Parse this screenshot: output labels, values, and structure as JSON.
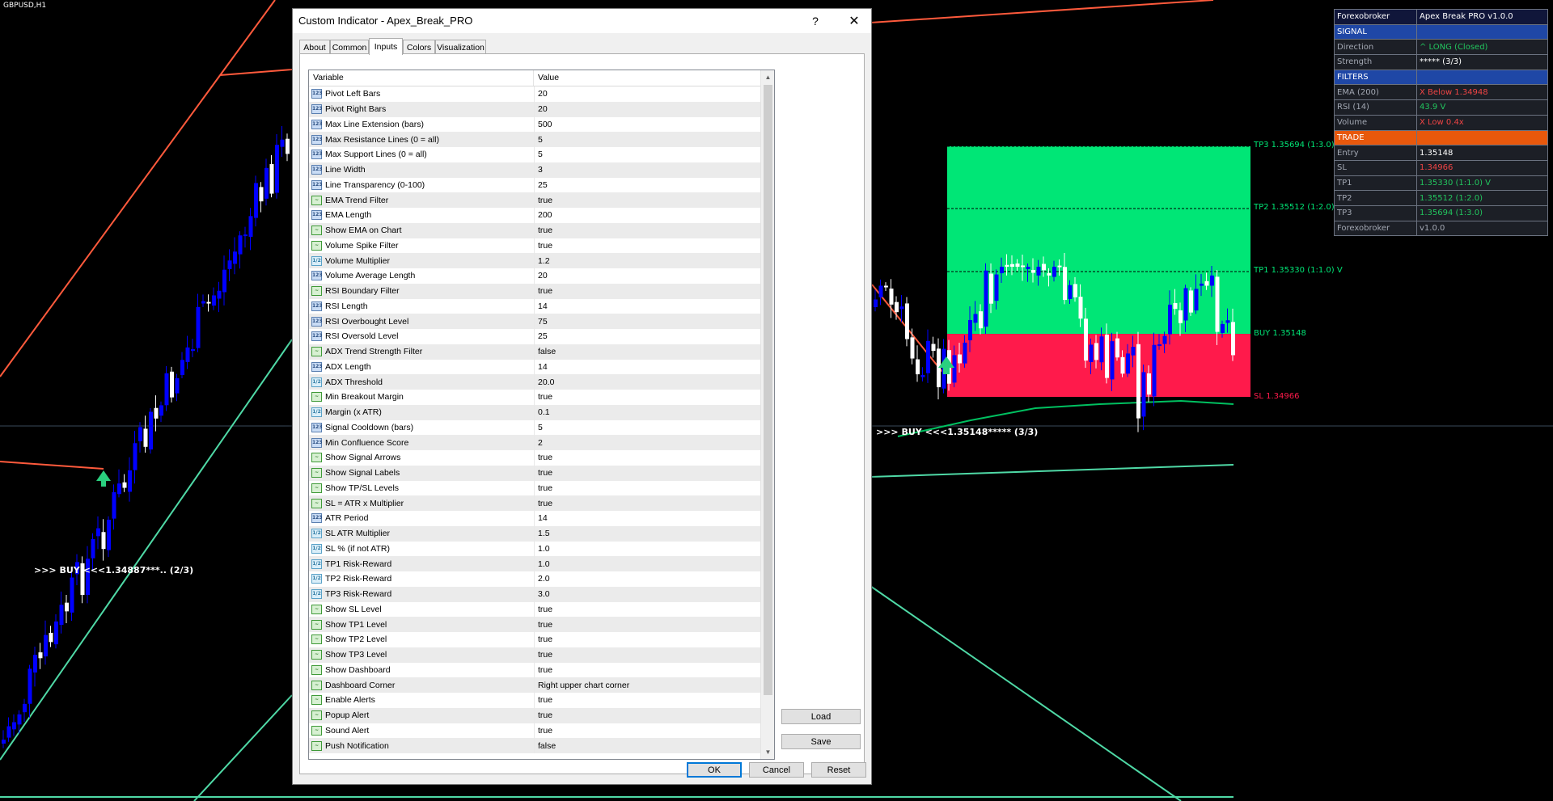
{
  "chart": {
    "symbol": "GBPUSD,H1",
    "buy_labels": [
      ">>> BUY <<<1.34887***.. (2/3)",
      ">>> BUY <<<1.35148***** (3/3)"
    ],
    "levels": {
      "tp3": "TP3 1.35694 (1:3.0)",
      "tp2": "TP2 1.35512 (1:2.0)",
      "tp1": "TP1 1.35330 (1:1.0) V",
      "buy": "BUY 1.35148",
      "sl": "SL 1.34966"
    },
    "colors": {
      "bull": "#0000ff",
      "bear": "#ffffff",
      "resistance": "#ff5a3c",
      "support": "#4fd9a6",
      "tp_zone": "#00e676",
      "sl_zone": "#ff1a4b",
      "arrow": "#2ad07f",
      "ema": "#00c060"
    }
  },
  "dashboard": {
    "rows": [
      {
        "type": "head",
        "k": "Forexobroker",
        "v": "Apex Break PRO v1.0.0"
      },
      {
        "type": "section",
        "k": "SIGNAL",
        "v": ""
      },
      {
        "type": "item",
        "k": "Direction",
        "v": "^ LONG (Closed)",
        "tone": "green"
      },
      {
        "type": "item",
        "k": "Strength",
        "v": "***** (3/3)",
        "tone": "white"
      },
      {
        "type": "section",
        "k": "FILTERS",
        "v": ""
      },
      {
        "type": "item",
        "k": "EMA (200)",
        "v": "X Below 1.34948",
        "tone": "red"
      },
      {
        "type": "item",
        "k": "RSI (14)",
        "v": "43.9 V",
        "tone": "green"
      },
      {
        "type": "item",
        "k": "Volume",
        "v": "X Low 0.4x",
        "tone": "red"
      },
      {
        "type": "trade",
        "k": "TRADE",
        "v": ""
      },
      {
        "type": "item",
        "k": "Entry",
        "v": "1.35148",
        "tone": "white"
      },
      {
        "type": "item",
        "k": "SL",
        "v": "1.34966",
        "tone": "red"
      },
      {
        "type": "item",
        "k": "TP1",
        "v": "1.35330 (1:1.0) V",
        "tone": "green"
      },
      {
        "type": "item",
        "k": "TP2",
        "v": "1.35512 (1:2.0)",
        "tone": "green"
      },
      {
        "type": "item",
        "k": "TP3",
        "v": "1.35694 (1:3.0)",
        "tone": "green"
      },
      {
        "type": "item",
        "k": "Forexobroker",
        "v": "v1.0.0",
        "tone": "grey"
      }
    ]
  },
  "dialog": {
    "title": "Custom Indicator - Apex_Break_PRO",
    "help": "?",
    "close": "✕",
    "tabs": [
      "About",
      "Common",
      "Inputs",
      "Colors",
      "Visualization"
    ],
    "active_tab": "Inputs",
    "columns": {
      "variable": "Variable",
      "value": "Value"
    },
    "params": [
      {
        "name": "Pivot Left Bars",
        "value": "20",
        "type": "int"
      },
      {
        "name": "Pivot Right Bars",
        "value": "20",
        "type": "int"
      },
      {
        "name": "Max Line Extension (bars)",
        "value": "500",
        "type": "int"
      },
      {
        "name": "Max Resistance Lines (0 = all)",
        "value": "5",
        "type": "int"
      },
      {
        "name": "Max Support Lines (0 = all)",
        "value": "5",
        "type": "int"
      },
      {
        "name": "Line Width",
        "value": "3",
        "type": "int"
      },
      {
        "name": "Line Transparency (0-100)",
        "value": "25",
        "type": "int"
      },
      {
        "name": "EMA Trend Filter",
        "value": "true",
        "type": "bool"
      },
      {
        "name": "EMA Length",
        "value": "200",
        "type": "int"
      },
      {
        "name": "Show EMA on Chart",
        "value": "true",
        "type": "bool"
      },
      {
        "name": "Volume Spike Filter",
        "value": "true",
        "type": "bool"
      },
      {
        "name": "Volume Multiplier",
        "value": "1.2",
        "type": "double"
      },
      {
        "name": "Volume Average Length",
        "value": "20",
        "type": "int"
      },
      {
        "name": "RSI Boundary Filter",
        "value": "true",
        "type": "bool"
      },
      {
        "name": "RSI Length",
        "value": "14",
        "type": "int"
      },
      {
        "name": "RSI Overbought Level",
        "value": "75",
        "type": "int"
      },
      {
        "name": "RSI Oversold Level",
        "value": "25",
        "type": "int"
      },
      {
        "name": "ADX Trend Strength Filter",
        "value": "false",
        "type": "bool"
      },
      {
        "name": "ADX Length",
        "value": "14",
        "type": "int"
      },
      {
        "name": "ADX Threshold",
        "value": "20.0",
        "type": "double"
      },
      {
        "name": "Min Breakout Margin",
        "value": "true",
        "type": "bool"
      },
      {
        "name": "Margin (x ATR)",
        "value": "0.1",
        "type": "double"
      },
      {
        "name": "Signal Cooldown (bars)",
        "value": "5",
        "type": "int"
      },
      {
        "name": "Min Confluence Score",
        "value": "2",
        "type": "int"
      },
      {
        "name": "Show Signal Arrows",
        "value": "true",
        "type": "bool"
      },
      {
        "name": "Show Signal Labels",
        "value": "true",
        "type": "bool"
      },
      {
        "name": "Show TP/SL Levels",
        "value": "true",
        "type": "bool"
      },
      {
        "name": "SL = ATR x Multiplier",
        "value": "true",
        "type": "bool"
      },
      {
        "name": "ATR Period",
        "value": "14",
        "type": "int"
      },
      {
        "name": "SL ATR Multiplier",
        "value": "1.5",
        "type": "double"
      },
      {
        "name": "SL % (if not ATR)",
        "value": "1.0",
        "type": "double"
      },
      {
        "name": "TP1 Risk-Reward",
        "value": "1.0",
        "type": "double"
      },
      {
        "name": "TP2 Risk-Reward",
        "value": "2.0",
        "type": "double"
      },
      {
        "name": "TP3 Risk-Reward",
        "value": "3.0",
        "type": "double"
      },
      {
        "name": "Show SL Level",
        "value": "true",
        "type": "bool"
      },
      {
        "name": "Show TP1 Level",
        "value": "true",
        "type": "bool"
      },
      {
        "name": "Show TP2 Level",
        "value": "true",
        "type": "bool"
      },
      {
        "name": "Show TP3 Level",
        "value": "true",
        "type": "bool"
      },
      {
        "name": "Show Dashboard",
        "value": "true",
        "type": "bool"
      },
      {
        "name": "Dashboard Corner",
        "value": "Right upper chart corner",
        "type": "enum"
      },
      {
        "name": "Enable Alerts",
        "value": "true",
        "type": "bool"
      },
      {
        "name": "Popup Alert",
        "value": "true",
        "type": "bool"
      },
      {
        "name": "Sound Alert",
        "value": "true",
        "type": "bool"
      },
      {
        "name": "Push Notification",
        "value": "false",
        "type": "bool"
      }
    ],
    "buttons": {
      "load": "Load",
      "save": "Save",
      "ok": "OK",
      "cancel": "Cancel",
      "reset": "Reset"
    }
  }
}
